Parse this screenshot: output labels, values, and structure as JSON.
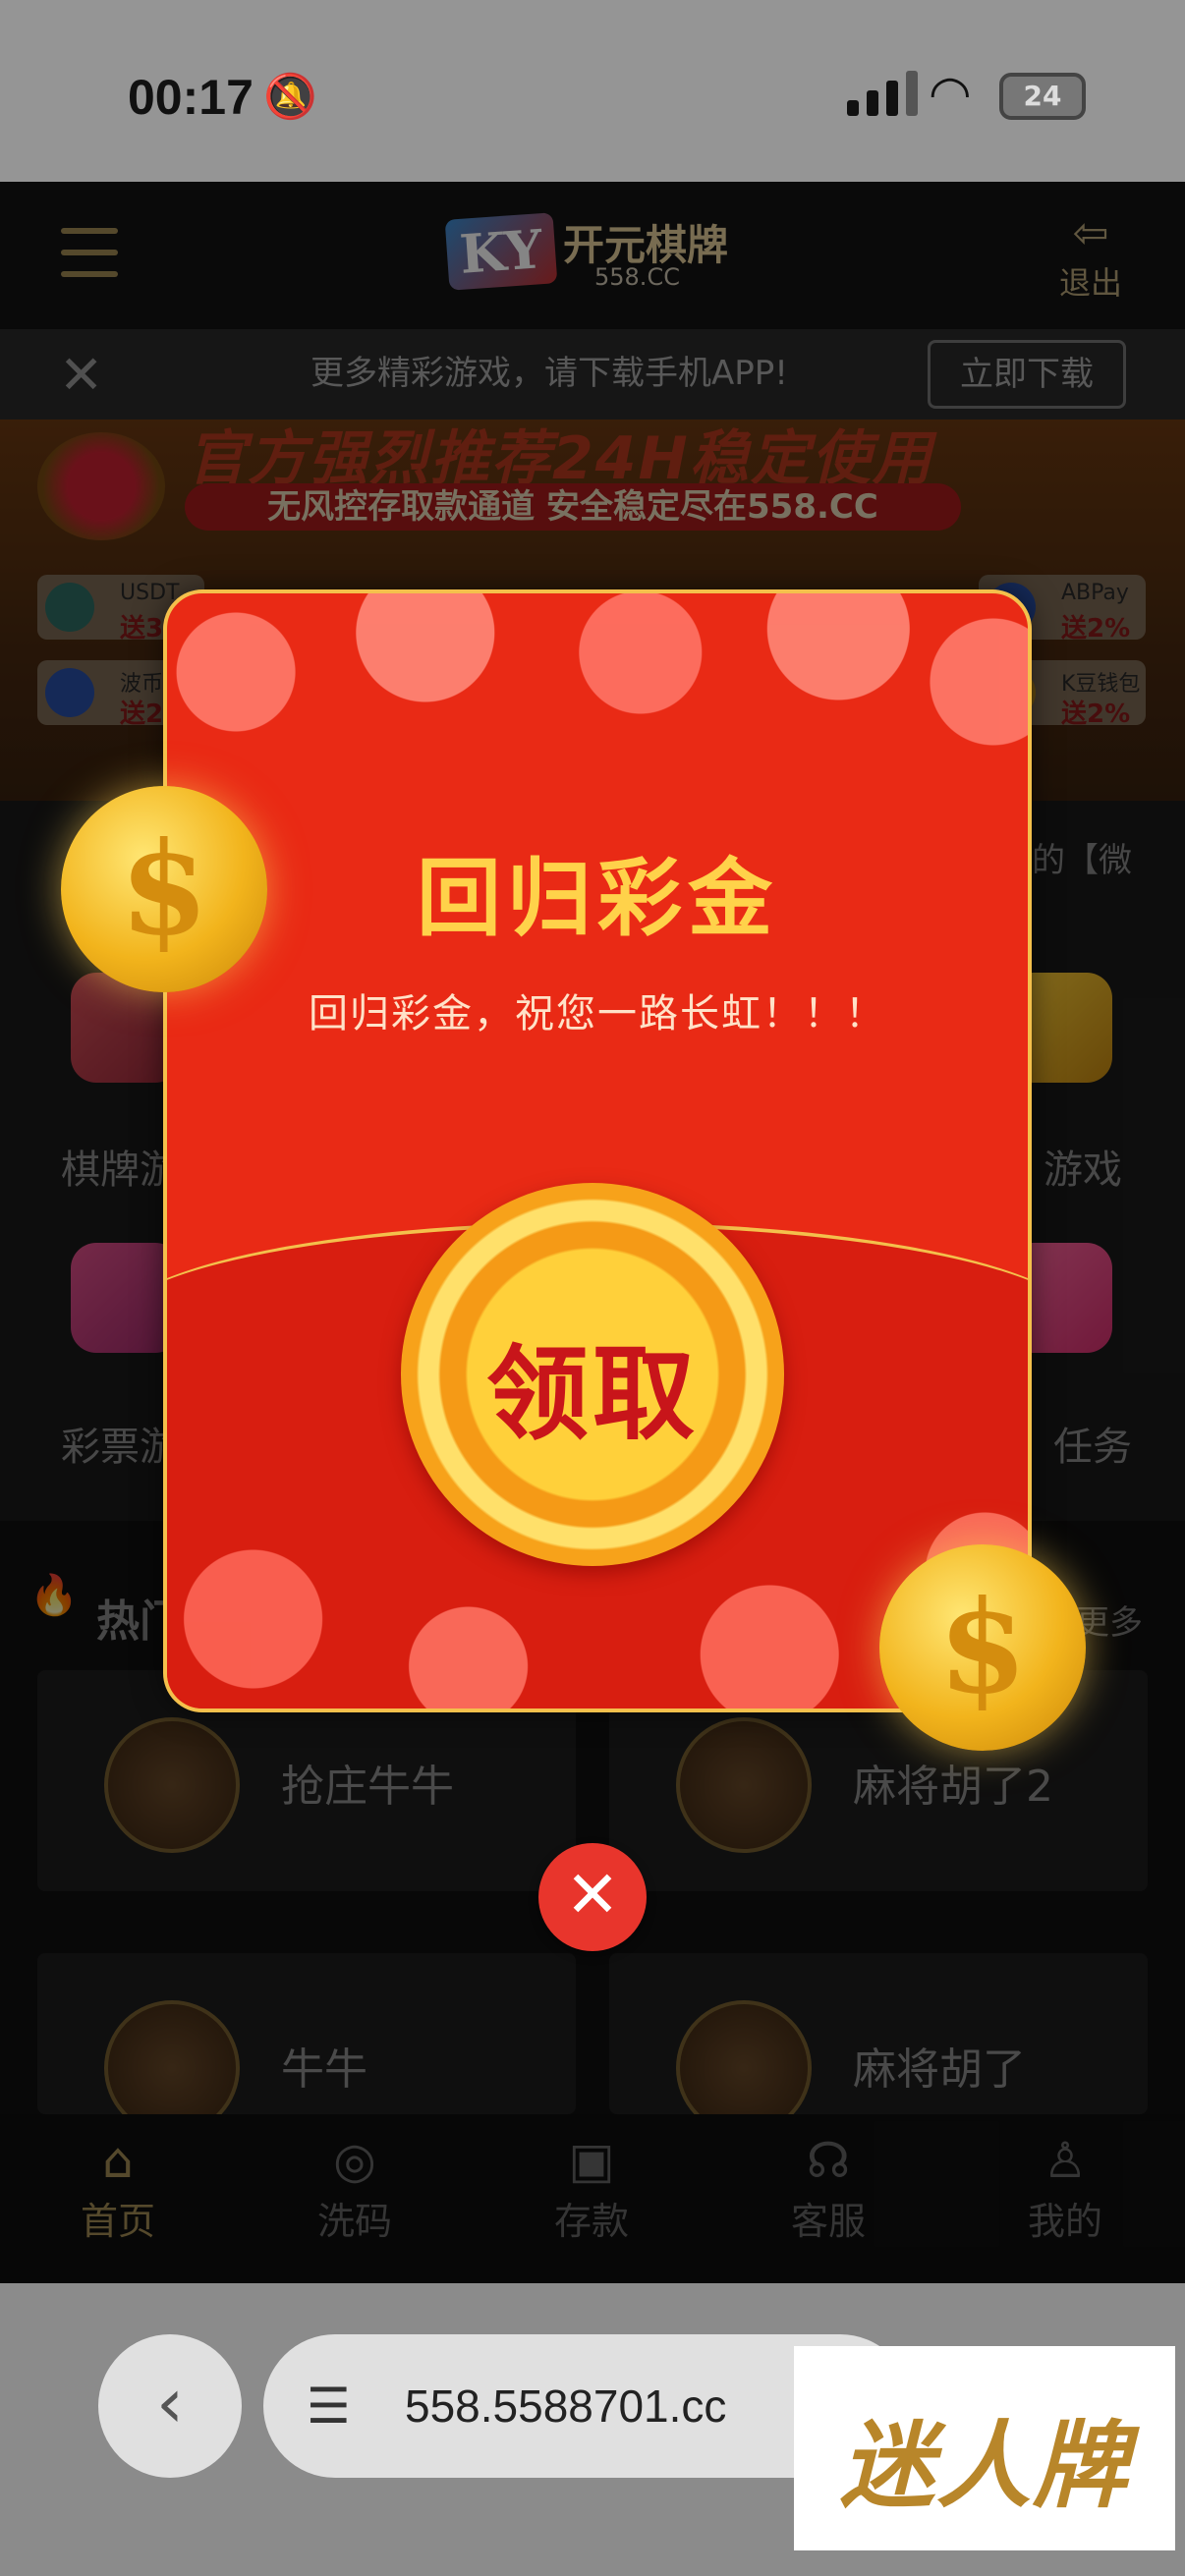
{
  "status_bar": {
    "time": "00:17",
    "battery": "24"
  },
  "header": {
    "logo_badge": "KY",
    "logo_name": "开元棋牌",
    "logo_domain": "558.CC",
    "logout_label": "退出"
  },
  "download_banner": {
    "text": "更多精彩游戏，请下载手机APP!",
    "button": "立即下载"
  },
  "promo": {
    "title": "官方强烈推荐24H稳定使用",
    "subtitle": "无风控存取款通道 安全稳定尽在558.CC",
    "payments": [
      {
        "name": "USDT",
        "bonus": "送3"
      },
      {
        "name": "ABPay",
        "bonus": "送2%"
      },
      {
        "name": "波币",
        "bonus": "送2"
      },
      {
        "name": "K豆钱包",
        "bonus": "送2%"
      }
    ]
  },
  "notice_tail": "的【微",
  "categories": [
    {
      "label": "棋牌游"
    },
    {
      "label": "游戏"
    },
    {
      "label": "彩票游"
    },
    {
      "label": "任务"
    }
  ],
  "hot": {
    "title": "热门",
    "more": "更多",
    "games": [
      {
        "name": "抢庄牛牛",
        "badge": "抢庄牛牛"
      },
      {
        "name": "麻将胡了2",
        "badge": "麻将胡了2"
      },
      {
        "name": "牛牛",
        "badge": "牛牛"
      },
      {
        "name": "麻将胡了",
        "badge": "麻将胡了"
      }
    ]
  },
  "bottom_nav": [
    {
      "label": "首页",
      "icon": "home-icon"
    },
    {
      "label": "洗码",
      "icon": "coin-icon"
    },
    {
      "label": "存款",
      "icon": "deposit-icon"
    },
    {
      "label": "客服",
      "icon": "support-icon"
    },
    {
      "label": "我的",
      "icon": "profile-icon"
    }
  ],
  "modal": {
    "title": "回归彩金",
    "message": "回归彩金，祝您一路长虹！！！",
    "claim": "领取"
  },
  "browser": {
    "url": "558.5588701.cc"
  },
  "watermark": "迷人牌",
  "colors": {
    "accent_gold": "#a48d55",
    "envelope_red": "#e92a15",
    "close_red": "#e8352c"
  }
}
